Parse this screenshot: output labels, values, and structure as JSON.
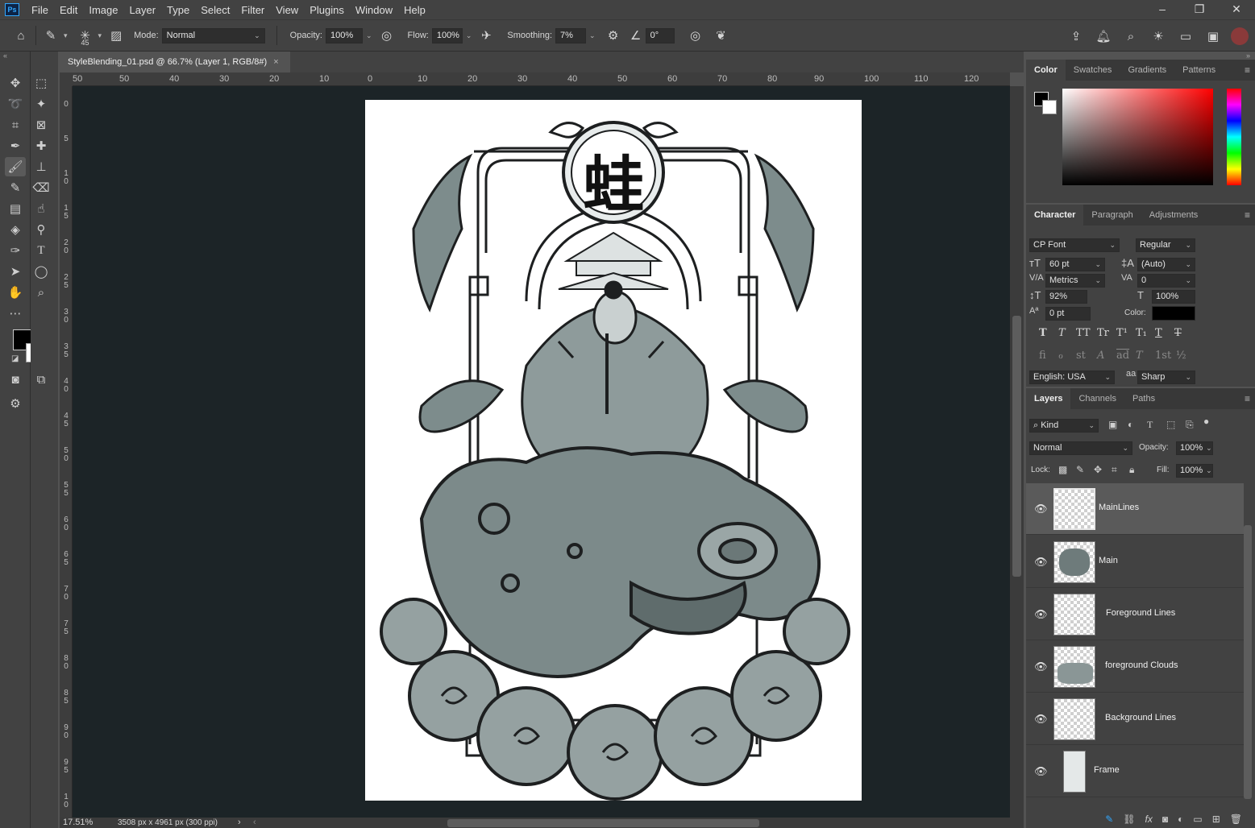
{
  "app": {
    "logo_text": "Ps",
    "menu": [
      "File",
      "Edit",
      "Image",
      "Layer",
      "Type",
      "Select",
      "Filter",
      "View",
      "Plugins",
      "Window",
      "Help"
    ],
    "window_controls": [
      "minimize-icon",
      "restore-icon",
      "close-icon"
    ]
  },
  "options_bar": {
    "brush_size": "45",
    "mode_label": "Mode:",
    "mode_value": "Normal",
    "opacity_label": "Opacity:",
    "opacity_value": "100%",
    "flow_label": "Flow:",
    "flow_value": "100%",
    "smoothing_label": "Smoothing:",
    "smoothing_value": "7%",
    "angle_value": "0°"
  },
  "document": {
    "tab_title": "StyleBlending_01.psd @ 66.7% (Layer 1, RGB/8#)",
    "close_glyph": "×",
    "zoom": "17.51%",
    "doc_info": "3508 px x 4961 px (300 ppi)",
    "status_next": "›",
    "status_prev": "‹",
    "glyph": "蛙"
  },
  "rulers": {
    "horizontal": [
      "50",
      "50",
      "40",
      "30",
      "20",
      "10",
      "0",
      "10",
      "20",
      "30",
      "40",
      "50",
      "60",
      "70",
      "80",
      "90",
      "100",
      "110",
      "120"
    ],
    "vertical": [
      "0",
      "5",
      "10",
      "15",
      "20",
      "25",
      "30",
      "35",
      "40",
      "45",
      "50",
      "55",
      "60",
      "65",
      "70",
      "75",
      "80",
      "85",
      "90",
      "95",
      "10"
    ]
  },
  "color_panel": {
    "tabs": [
      "Color",
      "Swatches",
      "Gradients",
      "Patterns"
    ],
    "foreground": "#000000",
    "background": "#ffffff"
  },
  "character_panel": {
    "tabs": [
      "Character",
      "Paragraph",
      "Adjustments"
    ],
    "font_family": "CP Font",
    "font_style": "Regular",
    "font_size": "60 pt",
    "leading": "(Auto)",
    "kerning": "Metrics",
    "tracking": "0",
    "vertical_scale": "92%",
    "horizontal_scale": "100%",
    "baseline_shift": "0 pt",
    "color_label": "Color:",
    "language": "English: USA",
    "antialias_prefix": "aa",
    "antialias": "Sharp",
    "style_glyphs": [
      "T",
      "T",
      "TT",
      "Tr",
      "T¹",
      "T₁",
      "T",
      "T"
    ],
    "opentype_glyphs": [
      "fi",
      "ℴ",
      "st",
      "A",
      "ad",
      "T",
      "1st",
      "½"
    ]
  },
  "layers_panel": {
    "tabs": [
      "Layers",
      "Channels",
      "Paths"
    ],
    "filter_kind": "Kind",
    "blend_mode": "Normal",
    "opacity_label": "Opacity:",
    "opacity_value": "100%",
    "lock_label": "Lock:",
    "fill_label": "Fill:",
    "fill_value": "100%",
    "layers": [
      {
        "name": "MainLines",
        "visible": true,
        "selected": true
      },
      {
        "name": "Main",
        "visible": true,
        "selected": false
      },
      {
        "name": "Foreground Lines",
        "visible": true,
        "selected": false
      },
      {
        "name": "foreground Clouds",
        "visible": true,
        "selected": false
      },
      {
        "name": "Background Lines",
        "visible": true,
        "selected": false
      },
      {
        "name": "Frame",
        "visible": true,
        "selected": false
      }
    ],
    "footer_icons": [
      "link-icon",
      "fx-icon",
      "mask-icon",
      "adjustment-icon",
      "folder-icon",
      "new-layer-icon",
      "trash-icon"
    ]
  },
  "colors": {
    "accent": "#31a8ff",
    "canvas_bg": "#1c2427",
    "panel_bg": "#424242"
  }
}
